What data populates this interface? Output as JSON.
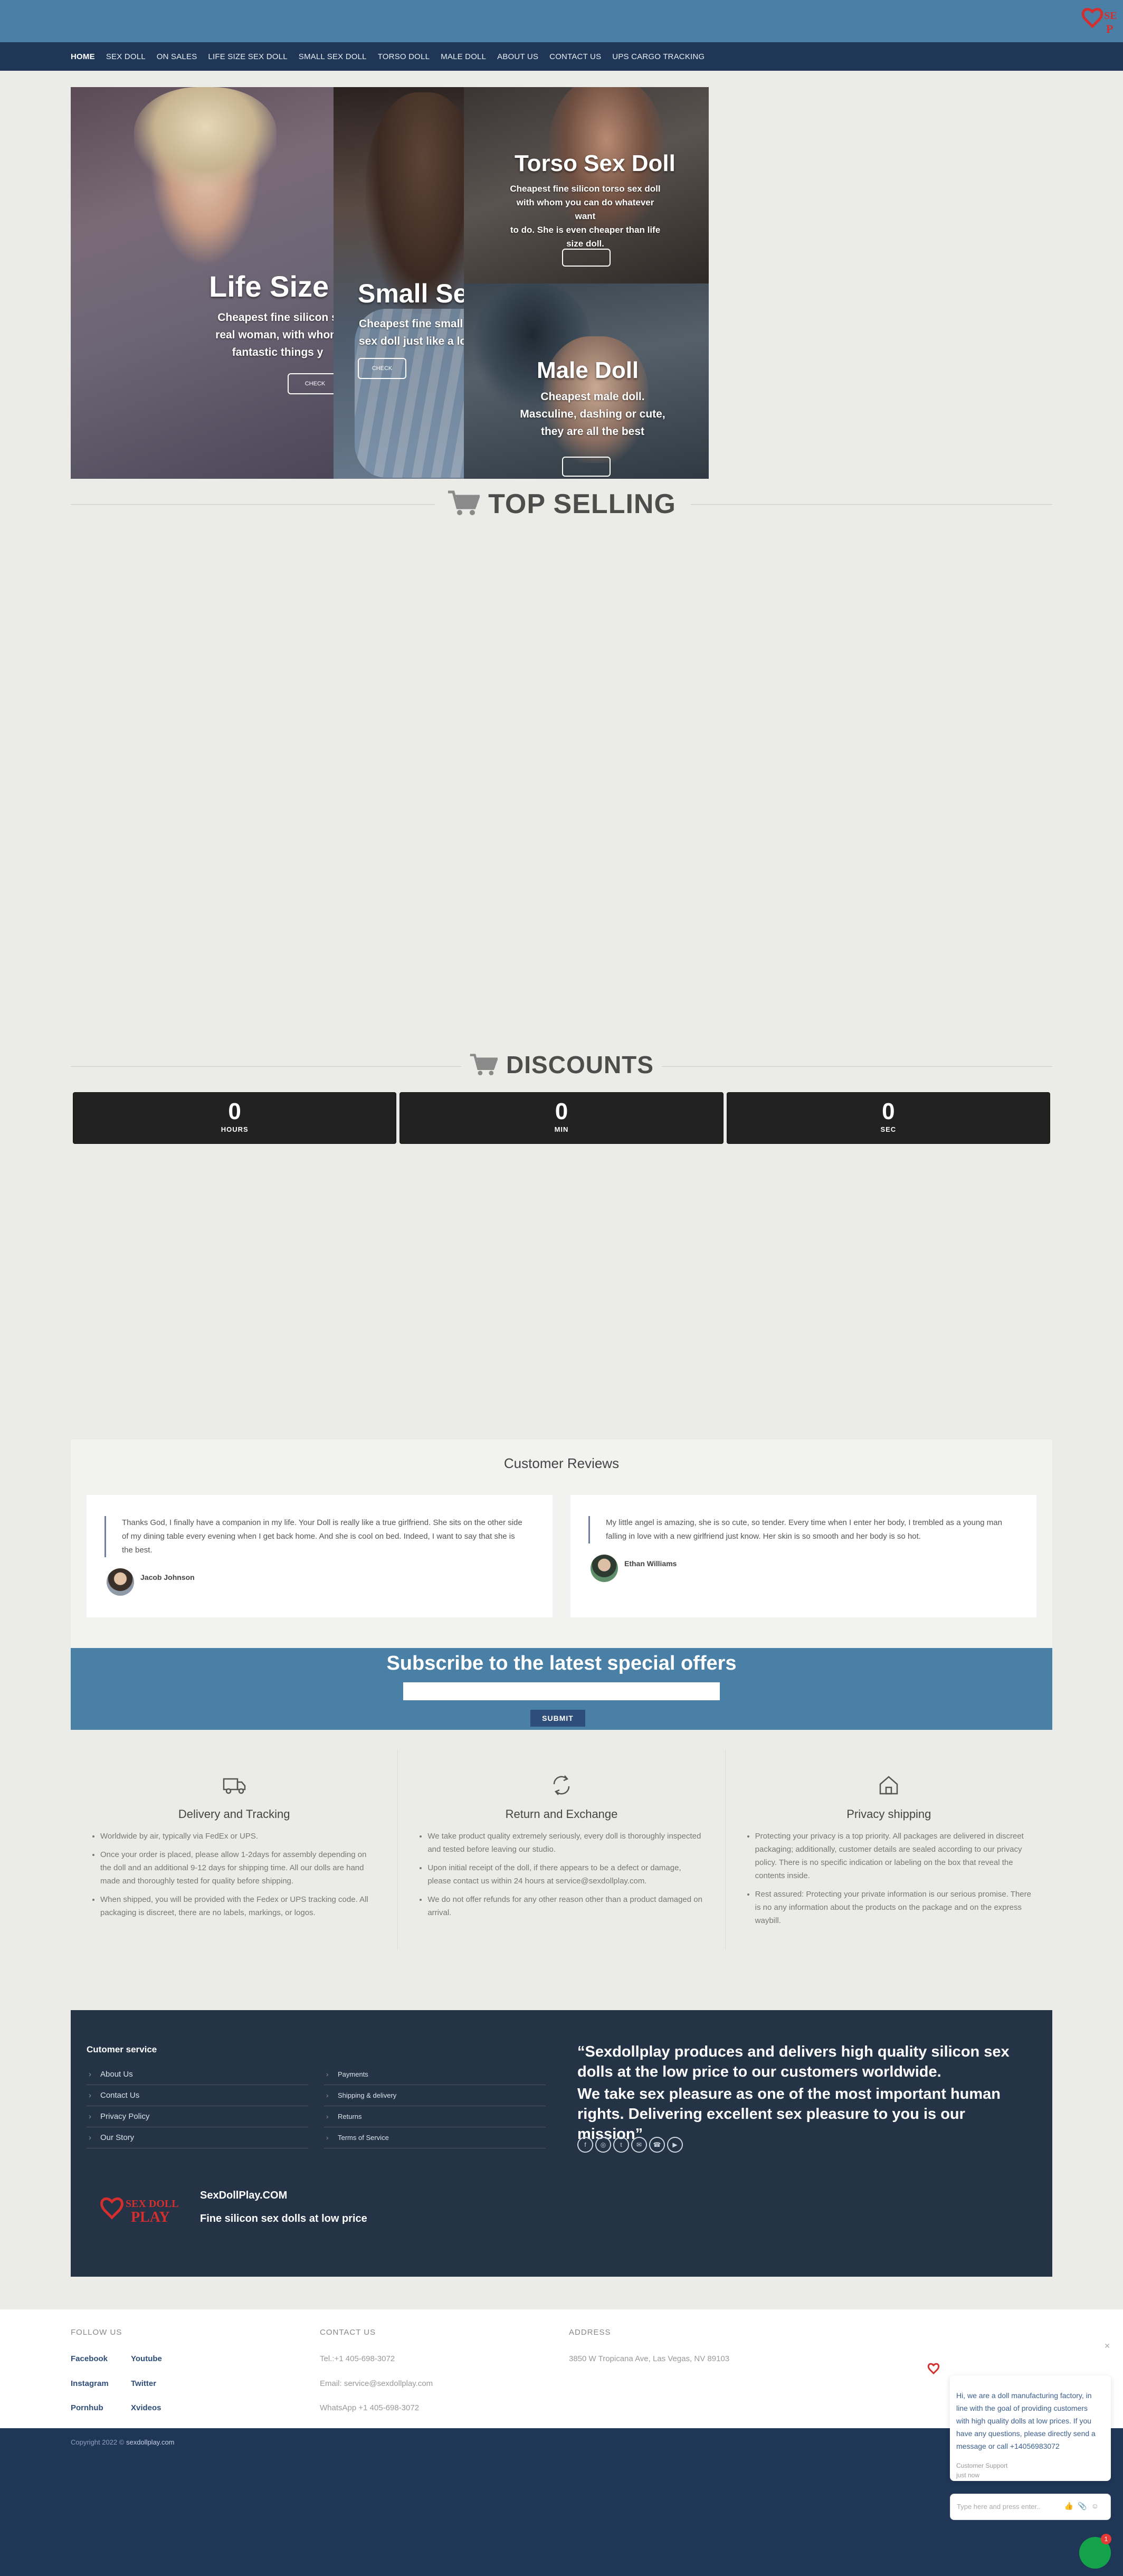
{
  "nav": {
    "items": [
      "HOME",
      "SEX DOLL",
      "ON SALES",
      "LIFE SIZE SEX DOLL",
      "SMALL SEX DOLL",
      "TORSO DOLL",
      "MALE DOLL",
      "ABOUT US",
      "CONTACT US",
      "UPS CARGO TRACKING"
    ],
    "active": "HOME"
  },
  "banner": {
    "life_size": {
      "title": "Life Size S",
      "sub": "Cheapest fine silicon s... real woman, with whom ... fantastic things y...",
      "sub_lines": [
        "Cheapest fine silicon s",
        "real woman, with whom",
        "fantastic things y"
      ],
      "button": "CHECK"
    },
    "small": {
      "title": "Small Sex Doll",
      "sub_lines": [
        "Cheapest fine small size silicon",
        "sex doll just like a lovely Lolita."
      ],
      "button": "CHECK"
    },
    "torso": {
      "title": "Torso Sex Doll",
      "sub_lines": [
        "Cheapest fine silicon torso sex doll",
        "with whom you can do whatever want",
        "to do. She is even cheaper than life",
        "size doll."
      ]
    },
    "male": {
      "title": "Male Doll",
      "sub_lines": [
        "Cheapest male doll.",
        "Masculine, dashing or cute,",
        "they are all the best"
      ]
    }
  },
  "top_selling": {
    "title": "TOP SELLING"
  },
  "discounts": {
    "title": "DISCOUNTS"
  },
  "countdown": [
    {
      "value": "0",
      "label": "HOURS"
    },
    {
      "value": "0",
      "label": "MIN"
    },
    {
      "value": "0",
      "label": "SEC"
    }
  ],
  "reviews": {
    "title": "Customer Reviews",
    "items": [
      {
        "text": "Thanks God, I finally have a companion in my life. Your Doll is really like a true girlfriend. She sits on the other side of my dining table every evening when I get back home. And she is cool on bed. Indeed, I want to say that she is the best.",
        "author": "Jacob Johnson"
      },
      {
        "text": "My little angel is amazing, she is so cute, so tender. Every time when I enter her body, I trembled as a young man falling in love with a new girlfriend just know. Her skin is so smooth and her body is so hot.",
        "author": "Ethan Williams"
      }
    ]
  },
  "subscribe": {
    "title": "Subscribe to the latest special offers",
    "input_placeholder": "",
    "button": "SUBMIT"
  },
  "features": [
    {
      "icon": "truck-icon",
      "title": "Delivery and Tracking",
      "points": [
        "Worldwide by air, typically via FedEx or UPS.",
        "Once your order is placed, please allow 1-2days for assembly depending on the doll and an additional 9-12 days for shipping time.  All our dolls are hand made and thoroughly tested for quality before shipping.",
        "When shipped, you will be provided with the Fedex or UPS tracking code.  All packaging is discreet, there are no labels, markings, or logos."
      ]
    },
    {
      "icon": "refresh-icon",
      "title": "Return and Exchange",
      "points": [
        "We take product quality extremely seriously, every doll is thoroughly inspected and tested before leaving our studio.",
        "Upon initial receipt of the doll, if there appears to be a defect or damage, please contact us within 24 hours at service@sexdollplay.com.",
        "We do not offer refunds for any other reason other than a product damaged on arrival."
      ]
    },
    {
      "icon": "home-icon",
      "title": "Privacy shipping",
      "points": [
        "Protecting your privacy is a top priority.  All packages are delivered in discreet packaging; additionally, customer details are sealed according to our privacy policy. There is no specific indication or labeling on the box that reveal the contents inside.",
        "Rest assured: Protecting your private information is our serious promise. There is no any information about the products on the package and on the express waybill."
      ]
    }
  ],
  "dark_footer": {
    "service_title": "Cutomer service",
    "col1": [
      "About Us",
      "Contact Us",
      "Privacy Policy",
      "Our Story"
    ],
    "col2": [
      "Payments",
      "Shipping & delivery",
      "Returns",
      "Terms of Service"
    ],
    "mission_1": "“Sexdollplay produces and delivers high quality silicon sex dolls at the low price to our customers worldwide.",
    "mission_2": "We take sex pleasure as one of the most important human rights. Delivering excellent sex pleasure to you is our mission”",
    "social": [
      "f",
      "◎",
      "t",
      "✉",
      "☎",
      "▶"
    ],
    "logo_line1": "SEX DOLL",
    "logo_line2": "PLAY",
    "brand": "SexDollPlay.COM",
    "tagline": "Fine silicon sex dolls at low price"
  },
  "light_footer": {
    "follow_title": "FOLLOW US",
    "follow_links": [
      [
        "Facebook",
        "Youtube"
      ],
      [
        "Instagram",
        "Twitter"
      ],
      [
        "Pornhub",
        "Xvideos"
      ]
    ],
    "contact_title": "CONTACT US",
    "contact_lines": [
      "Tel.:+1 405-698-3072",
      "Email: service@sexdollplay.com",
      "WhatsApp  +1 405-698-3072"
    ],
    "address_title": "ADDRESS",
    "address": "3850 W Tropicana Ave, Las Vegas, NV 89103"
  },
  "copyright": {
    "prefix": "Copyright 2022 © ",
    "site": "sexdollplay.com"
  },
  "chat": {
    "message": "Hi, we are a doll manufacturing factory, in line with the goal of providing customers with high quality dolls at low prices. If you have any questions, please directly send a message or call +14056983072",
    "agent": "Customer Support",
    "status": "just now",
    "input_placeholder": "Type here and press enter..",
    "badge": "1"
  },
  "colors": {
    "header": "#4a7fa6",
    "nav": "#1f3657",
    "dark_footer": "#243346",
    "chat_fab": "#14a34a",
    "logo_red": "#d32f2f"
  }
}
